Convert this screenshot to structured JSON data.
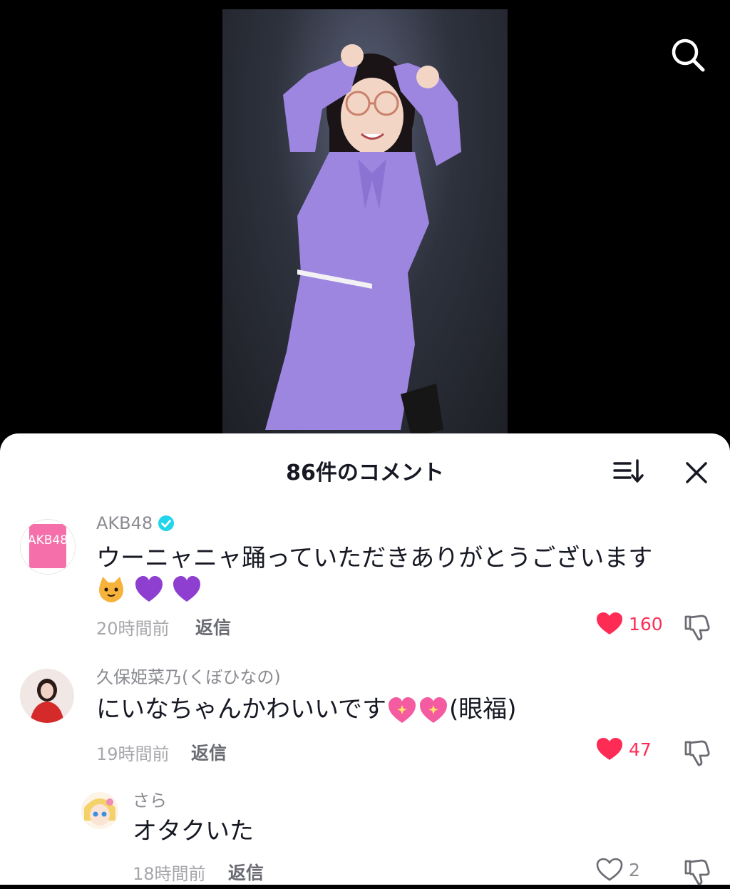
{
  "sheet": {
    "title": "86件のコメント"
  },
  "comments": [
    {
      "username": "AKB48",
      "verified": true,
      "avatar_text": "AKB48",
      "text_line1": "ウーニャニャ踊っていただきありがとうございます",
      "emojis": [
        "cat-face",
        "purple-heart",
        "purple-heart"
      ],
      "time": "20時間前",
      "reply": "返信",
      "likes": "160",
      "liked": true
    },
    {
      "username": "久保姫菜乃(くぼひなの)",
      "text_before": "にいなちゃんかわいいです",
      "text_after": "(眼福)",
      "emojis": [
        "sparkling-heart",
        "sparkling-heart"
      ],
      "time": "19時間前",
      "reply": "返信",
      "likes": "47",
      "liked": true
    },
    {
      "username": "さら",
      "text": "オタクいた",
      "time": "18時間前",
      "reply": "返信",
      "likes": "2",
      "liked": false
    }
  ],
  "colors": {
    "like_red": "#FE2C55",
    "verified_cyan": "#20D5EC",
    "dress_purple": "#9C86E0",
    "akb_pink": "#F56FAB"
  },
  "icons": [
    "search-icon",
    "sort-icon",
    "close-icon",
    "heart-icon",
    "dislike-icon",
    "verified-badge-icon"
  ]
}
